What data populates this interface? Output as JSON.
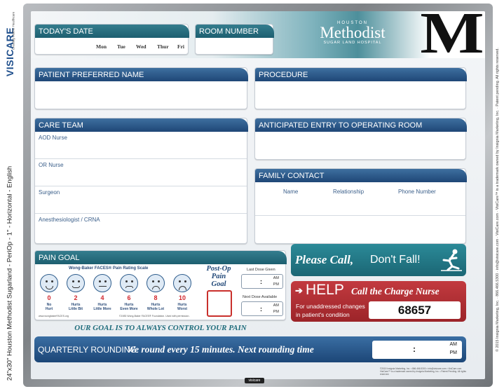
{
  "side": {
    "brand": "VISICARE",
    "brand_tagline": "Creating Visible Healthcare",
    "spec": "24\"x30\" Houston Methodist Sugarland - PeriOp - 1\" - Horizontal - English",
    "legal": "© 2015 Insignia Marketing, Inc. · 866.466.5300 · info@visicare.com · VisiCare.com · VisiCare™ is a trademark owned by Insignia Marketing, Inc. · Patent pending. All rights reserved."
  },
  "header": {
    "todays_date": "TODAY'S DATE",
    "days": [
      "Mon",
      "Tue",
      "Wed",
      "Thur",
      "Fri"
    ],
    "room_number": "ROOM NUMBER",
    "hospital_line1": "HOUSTON",
    "hospital_name": "Methodist",
    "hospital_line3": "SUGAR LAND HOSPITAL",
    "logo_letter": "M"
  },
  "sections": {
    "patient_name": "PATIENT PREFERRED NAME",
    "procedure": "PROCEDURE",
    "care_team": "CARE TEAM",
    "anticipated_entry": "ANTICIPATED ENTRY TO OPERATING ROOM",
    "family_contact": "FAMILY CONTACT",
    "pain_goal": "PAIN GOAL"
  },
  "care_team": [
    "AOD Nurse",
    "OR Nurse",
    "Surgeon",
    "Anesthesiologist / CRNA"
  ],
  "family_contact_cols": [
    "Name",
    "Relationship",
    "Phone Number"
  ],
  "pain": {
    "scale_title": "Wong-Baker FACES® Pain Rating Scale",
    "faces": [
      {
        "num": "0",
        "l1": "No",
        "l2": "Hurt"
      },
      {
        "num": "2",
        "l1": "Hurts",
        "l2": "Little Bit"
      },
      {
        "num": "4",
        "l1": "Hurts",
        "l2": "Little More"
      },
      {
        "num": "6",
        "l1": "Hurts",
        "l2": "Even More"
      },
      {
        "num": "8",
        "l1": "Hurts",
        "l2": "Whole Lot"
      },
      {
        "num": "10",
        "l1": "Hurts",
        "l2": "Worst"
      }
    ],
    "footnote_left": "www.wongbakerFACES.org",
    "footnote_right": "©1983 Wong-Baker FACES® Foundation. Used with permission.",
    "postop_l1": "Post-Op",
    "postop_l2": "Pain",
    "postop_l3": "Goal",
    "last_dose": "Last Dose Given",
    "next_dose": "Next Dose Available",
    "colon": ":",
    "am": "AM",
    "pm": "PM",
    "goal_banner": "OUR GOAL IS TO ALWAYS CONTROL YOUR PAIN"
  },
  "please_call": {
    "bold": "Please Call,",
    "rest": "Don't Fall!"
  },
  "help": {
    "arrow": "➔",
    "word": "HELP",
    "call": "Call the Charge Nurse",
    "sub1": "For unaddressed changes",
    "sub2": "in patient's condition",
    "number": "68657"
  },
  "quarterly": {
    "label": "QUARTERLY ROUNDING.",
    "text": "We round every 15 minutes. Next rounding time",
    "colon": ":",
    "am": "AM",
    "pm": "PM"
  },
  "footer": {
    "legal1": "©2015 Insignia Marketing, Inc. • 866.466.5300 • info@visicare.com • VisiCare.com",
    "legal2": "VisiCare™ is a trademark owned by Insignia Marketing, Inc. • Patent Pending. All rights reserved.",
    "badge": "visicare"
  },
  "colors": {
    "navy": "#1f4777",
    "teal": "#1d5f70",
    "red": "#b52f34"
  }
}
